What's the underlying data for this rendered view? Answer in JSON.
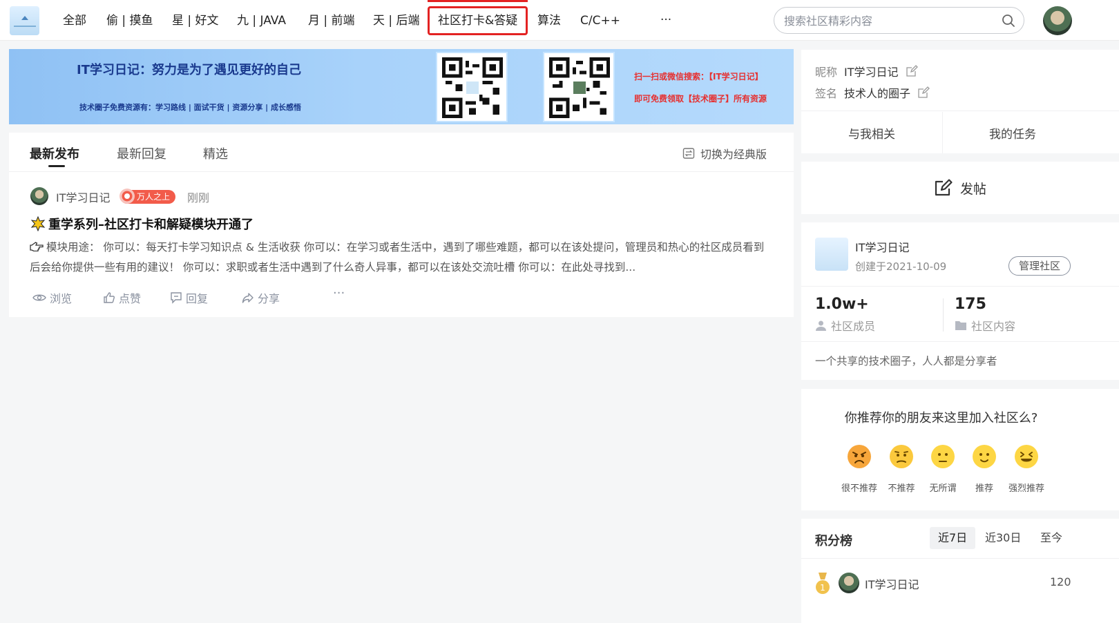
{
  "nav": {
    "items": [
      "全部",
      "偷 | 摸鱼",
      "星 | 好文",
      "九 | JAVA",
      "月 | 前端",
      "天 | 后端",
      "社区打卡&答疑",
      "算法",
      "C/C++",
      "···"
    ],
    "active_index": 6,
    "search_placeholder": "搜索社区精彩内容"
  },
  "banner": {
    "title": "IT学习日记：努力是为了遇见更好的自己",
    "subtitle": "技术圈子免费资源有：学习路线 | 面试干货 | 资源分享 | 成长感悟",
    "right_line1": "扫一扫或微信搜索：【IT学习日记】",
    "right_line2": "即可免费领取【技术圈子】所有资源"
  },
  "feed": {
    "tabs": [
      "最新发布",
      "最新回复",
      "精选"
    ],
    "active_tab": 0,
    "switch_label": "切换为经典版",
    "post": {
      "author": "IT学习日记",
      "badge": "万人之上",
      "time": "刚刚",
      "title": "重学系列–社区打卡和解疑模块开通了",
      "excerpt": "模块用途： 你可以：每天打卡学习知识点 & 生活收获 你可以：在学习或者生活中，遇到了哪些难题，都可以在该处提问，管理员和热心的社区成员看到后会给你提供一些有用的建议！ 你可以：求职或者生活中遇到了什么奇人异事，都可以在该处交流吐槽 你可以：在此处寻找到...",
      "actions": [
        "浏览",
        "点赞",
        "回复",
        "分享",
        "···"
      ]
    }
  },
  "profile": {
    "nickname_label": "昵称",
    "nickname": "IT学习日记",
    "sign_label": "签名",
    "sign": "技术人的圈子",
    "tabs": [
      "与我相关",
      "我的任务"
    ]
  },
  "post_button": "发帖",
  "community": {
    "name": "IT学习日记",
    "created": "创建于2021-10-09",
    "manage": "管理社区",
    "members_count": "1.0w+",
    "members_label": "社区成员",
    "content_count": "175",
    "content_label": "社区内容",
    "description": "一个共享的技术圈子，人人都是分享者"
  },
  "recommend": {
    "question": "你推荐你的朋友来这里加入社区么?",
    "options": [
      "很不推荐",
      "不推荐",
      "无所谓",
      "推荐",
      "强烈推荐"
    ]
  },
  "rank": {
    "title": "积分榜",
    "tabs": [
      "近7日",
      "近30日",
      "至今"
    ],
    "active_tab": 0,
    "entries": [
      {
        "rank": "1",
        "name": "IT学习日记",
        "score": "120"
      }
    ]
  },
  "colors": {
    "accent_red": "#e32222",
    "badge": "#f25b4a",
    "banner_title": "#1a3a8e"
  }
}
